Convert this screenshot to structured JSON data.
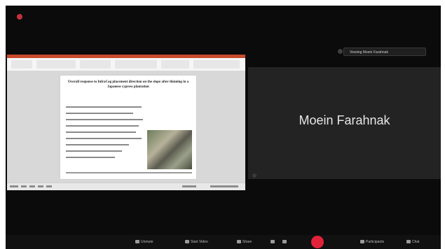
{
  "recording": {
    "accent": "#c9303a"
  },
  "shared_screen": {
    "app": "PowerPoint",
    "slide": {
      "title": "Overall response to InfraCog placement direction on the slope after thinning in a Japanese cypress plantation"
    }
  },
  "participant": {
    "name": "Moein Farahnak",
    "tile_bg": "#232323"
  },
  "viewing_banner": {
    "text": "Viewing Moein Farahnak"
  },
  "toolbar": {
    "unmute": "Unmute",
    "start_video": "Start Video",
    "share": "Share",
    "participants": "Participants",
    "chat": "Chat",
    "record_color": "#e0233a"
  }
}
